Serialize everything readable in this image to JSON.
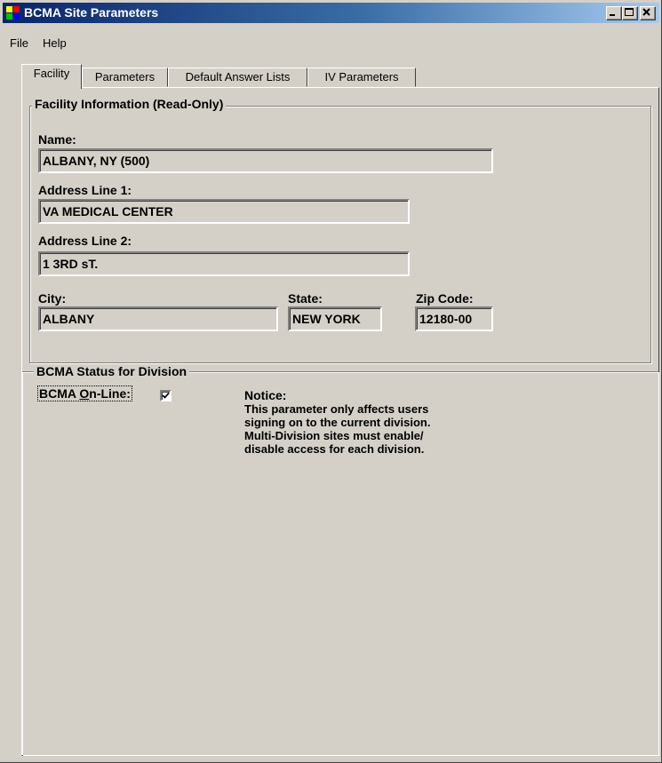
{
  "window": {
    "title": "BCMA Site Parameters",
    "controls": {
      "minimize": "_",
      "maximize": "□",
      "close": "X"
    }
  },
  "menu": {
    "items": [
      "File",
      "Help"
    ]
  },
  "tabs": [
    {
      "label": "Facility",
      "selected": true
    },
    {
      "label": "Parameters",
      "selected": false
    },
    {
      "label": "Default Answer Lists",
      "selected": false
    },
    {
      "label": "IV Parameters",
      "selected": false
    }
  ],
  "facility": {
    "group_title": "Facility Information (Read-Only)",
    "name_label": "Name:",
    "name_value": "ALBANY, NY (500)",
    "address1_label": "Address Line 1:",
    "address1_value": "VA MEDICAL CENTER",
    "address2_label": "Address Line 2:",
    "address2_value": "1 3RD sT.",
    "city_label": "City:",
    "city_value": "ALBANY",
    "state_label": "State:",
    "state_value": "NEW YORK",
    "zip_label": "Zip Code:",
    "zip_value": "12180-00"
  },
  "division": {
    "group_title": "BCMA Status for Division",
    "online_label": "BCMA On-Line:",
    "online_checked": true,
    "notice_title": "Notice:",
    "notice_lines": [
      "This parameter only affects users",
      "signing on to the current division.",
      "Multi-Division sites must enable/",
      "disable access for each division."
    ]
  },
  "colors": {
    "title_gradient_start": "#0a246a",
    "title_gradient_end": "#a6caf0",
    "face": "#d4d0c8"
  }
}
